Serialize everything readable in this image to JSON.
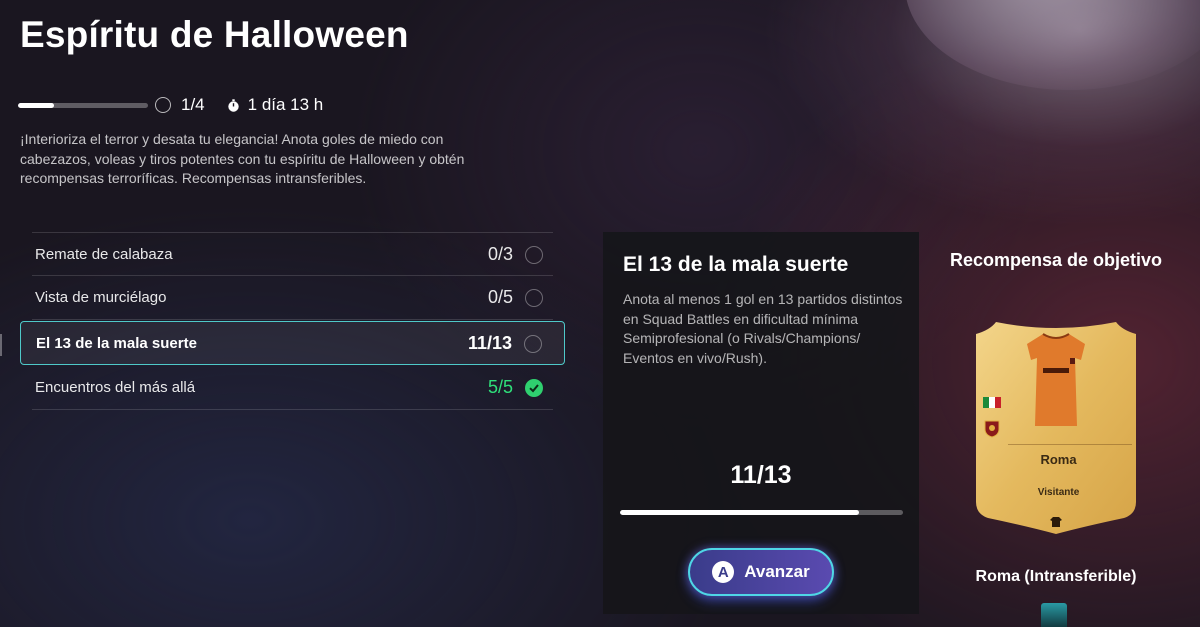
{
  "header": {
    "title": "Espíritu de Halloween",
    "progress_label": "1/4",
    "progress_fraction": 0.28,
    "timer_icon": "stopwatch-icon",
    "time_remaining": "1 día 13 h"
  },
  "description": "¡Interioriza el terror y desata tu elegancia! Anota goles de miedo con cabezazos, voleas y tiros potentes con tu espíritu de Halloween y obtén recompensas terroríficas. Recompensas intransferibles.",
  "objectives": [
    {
      "label": "Remate de calabaza",
      "count": "0/3",
      "done": false
    },
    {
      "label": "Vista de murciélago",
      "count": "0/5",
      "done": false
    },
    {
      "label": "El 13 de la mala suerte",
      "count": "11/13",
      "done": false,
      "selected": true
    },
    {
      "label": "Encuentros del más allá",
      "count": "5/5",
      "done": true
    }
  ],
  "detail": {
    "title": "El 13 de la mala suerte",
    "description": "Anota al menos 1 gol en 13 partidos distintos en Squad Battles en dificultad mínima Semiprofesional (o Rivals/Champions/ Eventos en vivo/Rush).",
    "count": "11/13",
    "progress_fraction": 0.8462,
    "button_glyph": "A",
    "button_label": "Avanzar"
  },
  "reward": {
    "title": "Recompensa de objetivo",
    "card_name": "Roma",
    "card_kit": "Visitante",
    "card_icons": [
      "jersey-icon",
      "italy-flag-icon",
      "club-badge-icon",
      "shirt-icon"
    ],
    "caption": "Roma (Intransferible)"
  },
  "colors": {
    "accent": "#4fc9c9",
    "complete": "#2fe07a",
    "card_gold": "#e4b95e",
    "jersey_orange": "#e07a2c",
    "button_start": "#3a3c8a",
    "button_end": "#5a4ab0"
  }
}
